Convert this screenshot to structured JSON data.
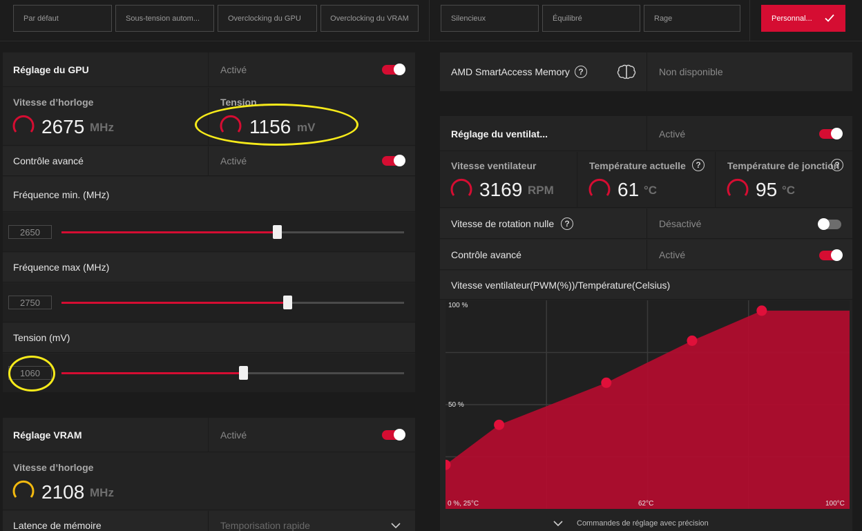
{
  "presets": [
    {
      "label": "Par défaut"
    },
    {
      "label": "Sous-tension autom..."
    },
    {
      "label": "Overclocking du GPU"
    },
    {
      "label": "Overclocking du VRAM"
    },
    {
      "label": "Silencieux"
    },
    {
      "label": "Équilibré"
    },
    {
      "label": "Rage"
    },
    {
      "label": "Personnal...",
      "active": true
    }
  ],
  "gpu": {
    "title": "Réglage du GPU",
    "status": "Activé",
    "clock_label": "Vitesse d’horloge",
    "clock_value": "2675",
    "clock_unit": "MHz",
    "voltage_label": "Tension",
    "voltage_value": "1156",
    "voltage_unit": "mV",
    "advanced_label": "Contrôle avancé",
    "advanced_status": "Activé",
    "freq_min_label": "Fréquence min. (MHz)",
    "freq_min_value": "2650",
    "freq_min_fraction": 0.63,
    "freq_max_label": "Fréquence max (MHz)",
    "freq_max_value": "2750",
    "freq_max_fraction": 0.66,
    "tension_label": "Tension (mV)",
    "tension_value": "1060",
    "tension_fraction": 0.53
  },
  "vram": {
    "title": "Réglage VRAM",
    "status": "Activé",
    "clock_label": "Vitesse d’horloge",
    "clock_value": "2108",
    "clock_unit": "MHz",
    "latency_label": "Latence de mémoire",
    "latency_value": "Temporisation rapide"
  },
  "sam": {
    "label": "AMD SmartAccess Memory",
    "status": "Non disponible"
  },
  "fan": {
    "title": "Réglage du ventilat...",
    "status": "Activé",
    "speed_label": "Vitesse ventilateur",
    "speed_value": "3169",
    "speed_unit": "RPM",
    "temp_label": "Température actuelle",
    "temp_value": "61",
    "temp_unit": "°C",
    "junction_label": "Température de jonction",
    "junction_value": "95",
    "junction_unit": "°C",
    "zero_rpm_label": "Vitesse de rotation nulle",
    "zero_rpm_status": "Désactivé",
    "advanced_label": "Contrôle avancé",
    "advanced_status": "Activé",
    "curve_label": "Vitesse ventilateur(PWM(%))/Température(Celsius)",
    "precision_label": "Commandes de réglage avec précision"
  },
  "colors": {
    "accent": "#d50d32",
    "gauge_vram": "#f2b90f",
    "annotation": "#f6ea1a"
  },
  "chart_data": {
    "type": "area",
    "x_unit": "°C",
    "y_unit": "%",
    "xlim": [
      25,
      100
    ],
    "ylim": [
      0,
      100
    ],
    "x_tick_labels": [
      "0 %, 25°C",
      "62°C",
      "100°C"
    ],
    "y_tick_labels": [
      "100 %",
      "50 %"
    ],
    "points": [
      {
        "x": 25,
        "y": 22
      },
      {
        "x": 35,
        "y": 42
      },
      {
        "x": 55,
        "y": 63
      },
      {
        "x": 71,
        "y": 84
      },
      {
        "x": 84,
        "y": 99
      }
    ]
  }
}
